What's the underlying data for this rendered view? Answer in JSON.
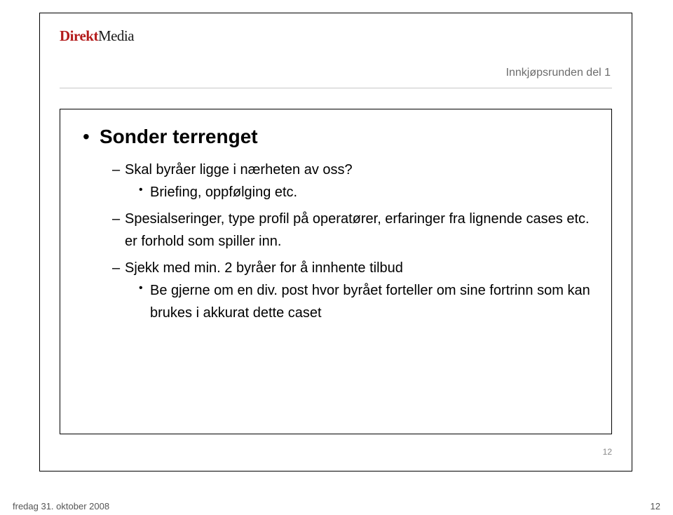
{
  "logo": {
    "part1": "Direkt",
    "part2": "Media"
  },
  "topic": "Innkjøpsrunden del 1",
  "heading": "Sonder terrenget",
  "items": {
    "a": "Skal byråer ligge i nærheten av oss?",
    "a1": "Briefing, oppfølging etc.",
    "b": "Spesialseringer, type profil på operatører, erfaringer fra lignende cases etc. er forhold som spiller inn.",
    "c": "Sjekk med min. 2 byråer for å innhente tilbud",
    "c1": "Be gjerne om en div. post hvor byrået forteller om sine fortrinn som kan brukes i akkurat dette caset"
  },
  "slide_number_inner": "12",
  "footer_date": "fredag 31. oktober 2008",
  "footer_page": "12"
}
